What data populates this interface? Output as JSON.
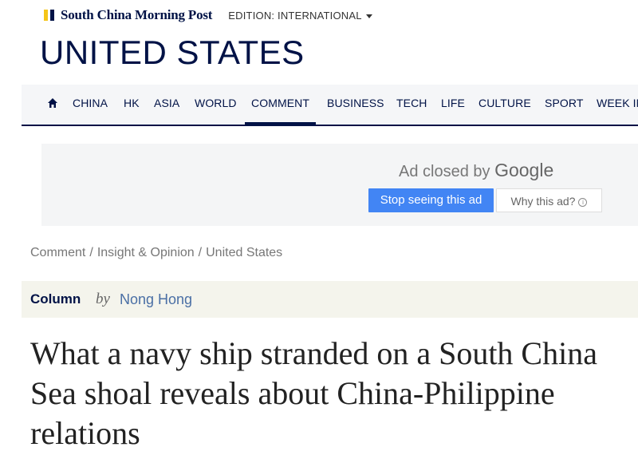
{
  "header": {
    "logo_text": "South China Morning Post",
    "edition_label": "EDITION: INTERNATIONAL",
    "section_title": "UNITED STATES"
  },
  "nav": {
    "items": [
      "CHINA",
      "HK",
      "ASIA",
      "WORLD",
      "COMMENT",
      "BUSINESS",
      "TECH",
      "LIFE",
      "CULTURE",
      "SPORT",
      "WEEK IN"
    ],
    "active": "COMMENT"
  },
  "ad": {
    "closed_text": "Ad closed by",
    "google": "Google",
    "stop_button": "Stop seeing this ad",
    "why_button": "Why this ad?"
  },
  "breadcrumb": {
    "items": [
      "Comment",
      "Insight & Opinion",
      "United States"
    ],
    "separator": "/"
  },
  "column": {
    "label": "Column",
    "by": "by",
    "author": "Nong Hong"
  },
  "article": {
    "headline": "What a navy ship stranded on a South China Sea shoal reveals about China-Philippine relations"
  },
  "colors": {
    "brand_navy": "#001246",
    "brand_yellow": "#f5c518",
    "ad_button_blue": "#4285f4"
  }
}
